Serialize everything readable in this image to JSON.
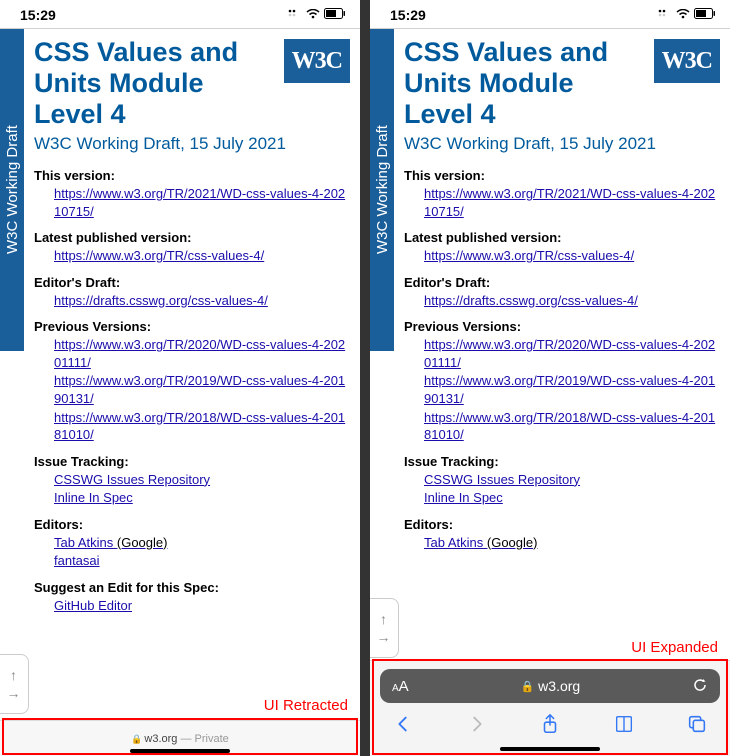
{
  "status": {
    "time": "15:29",
    "signal": "••",
    "wifi": "wifi",
    "battery": "battery-half"
  },
  "draft_label": "W3C Working Draft",
  "w3c_logo_text": "W3C",
  "title": "CSS Values and Units Module Level 4",
  "subtitle": "W3C Working Draft, 15 July 2021",
  "sections": {
    "this_version": {
      "label": "This version:",
      "links": [
        "https://www.w3.org/TR/2021/WD-css-values-4-20210715/"
      ]
    },
    "latest": {
      "label": "Latest published version:",
      "links": [
        "https://www.w3.org/TR/css-values-4/"
      ]
    },
    "editors_draft": {
      "label": "Editor's Draft:",
      "links": [
        "https://drafts.csswg.org/css-values-4/"
      ]
    },
    "previous": {
      "label": "Previous Versions:",
      "links": [
        "https://www.w3.org/TR/2020/WD-css-values-4-20201111/",
        "https://www.w3.org/TR/2019/WD-css-values-4-20190131/",
        "https://www.w3.org/TR/2018/WD-css-values-4-20181010/"
      ]
    },
    "issue_tracking": {
      "label": "Issue Tracking:",
      "links": [
        "CSSWG Issues Repository",
        "Inline In Spec"
      ]
    },
    "editors": {
      "label": "Editors:",
      "items": [
        {
          "name": "Tab Atkins",
          "affiliation": "(Google)"
        },
        {
          "name": "fantasai",
          "affiliation": ""
        }
      ]
    },
    "suggest_edit": {
      "label": "Suggest an Edit for this Spec:",
      "links": [
        "GitHub Editor"
      ]
    }
  },
  "browser_min": {
    "domain": "w3.org",
    "private_label": "— Private"
  },
  "browser_exp": {
    "aa_label": "AA",
    "domain": "w3.org",
    "refresh_icon": "refresh",
    "back_icon": "chevron-left",
    "forward_icon": "chevron-right",
    "share_icon": "share",
    "bookmarks_icon": "book",
    "tabs_icon": "tabs"
  },
  "captions": {
    "retracted": "UI Retracted",
    "expanded": "UI Expanded"
  }
}
